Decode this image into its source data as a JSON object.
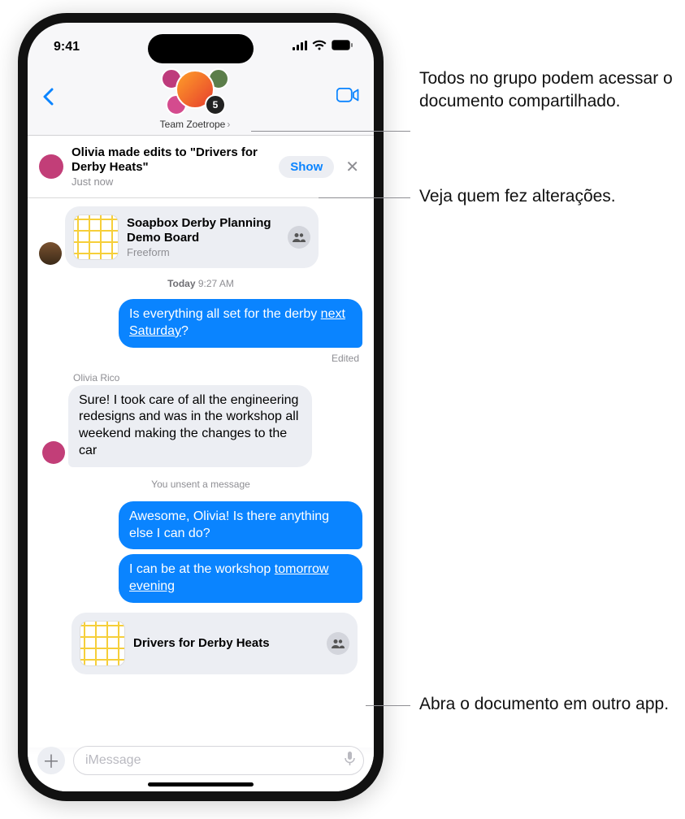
{
  "status": {
    "time": "9:41"
  },
  "header": {
    "group_name": "Team Zoetrope",
    "avatar_badge": "5"
  },
  "banner": {
    "title": "Olivia made edits to \"Drivers for Derby Heats\"",
    "subtitle": "Just now",
    "show_label": "Show"
  },
  "attach1": {
    "title": "Soapbox Derby Planning Demo Board",
    "app": "Freeform"
  },
  "timestamp": {
    "day": "Today",
    "time": "9:27 AM"
  },
  "msg1": {
    "prefix": "Is everything all set for the derby ",
    "link": "next Saturday",
    "suffix": "?"
  },
  "edited_label": "Edited",
  "sender_olivia": "Olivia Rico",
  "msg2": "Sure! I took care of all the engineering redesigns and was in the workshop all weekend making the changes to the car",
  "system_unsent": "You unsent a message",
  "msg3": "Awesome, Olivia! Is there anything else I can do?",
  "msg4": {
    "prefix": "I can be at the workshop ",
    "link": "tomorrow evening"
  },
  "attach2": {
    "title": "Drivers for Derby Heats"
  },
  "composer": {
    "placeholder": "iMessage"
  },
  "callouts": {
    "c1": "Todos no grupo podem acessar o documento compartilhado.",
    "c2": "Veja quem fez alterações.",
    "c3": "Abra o documento em outro app."
  }
}
